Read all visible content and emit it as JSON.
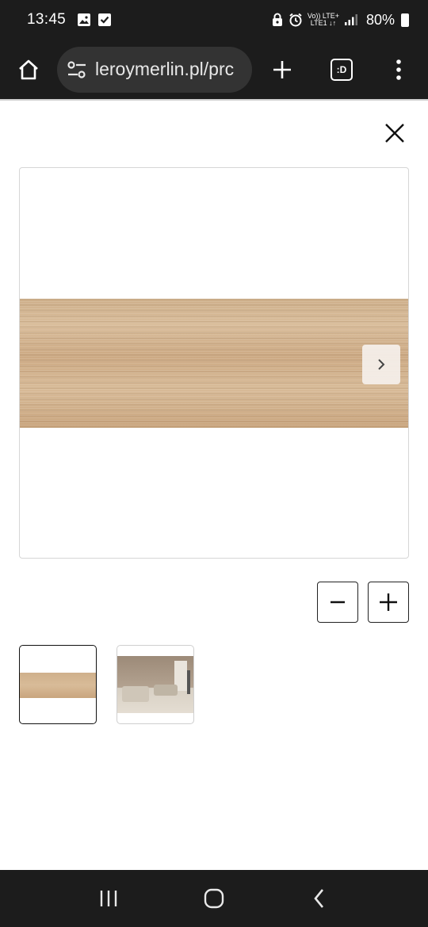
{
  "status_bar": {
    "time": "13:45",
    "network_top": "Vo)) LTE+",
    "network_bottom": "LTE1 ↓↑",
    "battery_percent": "80%",
    "icons": [
      "image-icon",
      "checkbox-icon",
      "lock-icon",
      "alarm-icon",
      "signal-icon",
      "battery-icon"
    ]
  },
  "browser": {
    "url_text": "leroymerlin.pl/prc",
    "tab_switcher_label": ":D",
    "icons": [
      "home-icon",
      "site-settings-icon",
      "new-tab-icon",
      "tab-switcher-icon",
      "more-menu-icon"
    ]
  },
  "gallery": {
    "close_icon": "close-icon",
    "next_icon": "chevron-right-icon",
    "zoom_out_icon": "minus-icon",
    "zoom_in_icon": "plus-icon",
    "thumbnails": [
      "wood-tile",
      "living-room"
    ],
    "selected_thumbnail": 0
  },
  "nav_bar": {
    "icons": [
      "recent-apps-icon",
      "home-nav-icon",
      "back-icon"
    ]
  },
  "colors": {
    "system_bar": "#1c1c1c",
    "url_pill": "#333333",
    "wood": "#d2b38f"
  }
}
